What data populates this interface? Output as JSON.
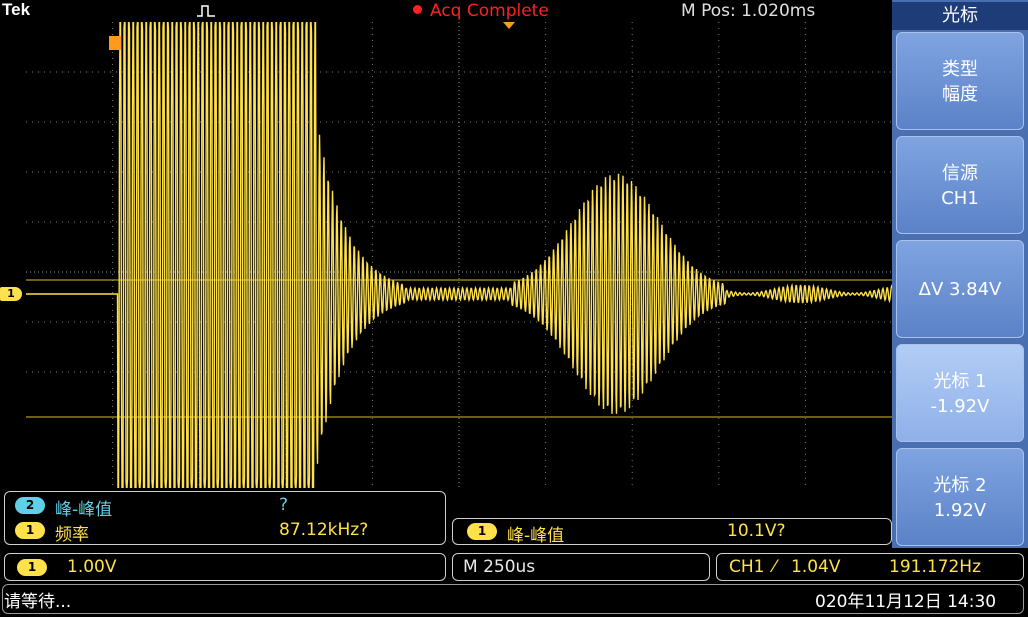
{
  "header": {
    "brand": "Tek",
    "acquisition_status": "Acq Complete",
    "position_readout": "M Pos: 1.020ms",
    "status_color": "#ff2020"
  },
  "channel_marker": "1",
  "side_menu": {
    "title": "光标",
    "buttons": [
      {
        "line1": "类型",
        "line2": "幅度"
      },
      {
        "line1": "信源",
        "line2": "CH1"
      },
      {
        "line1": "ΔV 3.84V",
        "line2": ""
      },
      {
        "line1": "光标 1",
        "line2": "-1.92V"
      },
      {
        "line1": "光标 2",
        "line2": "1.92V"
      }
    ]
  },
  "measurements": {
    "left": [
      {
        "channel": "2",
        "name": "峰-峰值",
        "value": "?"
      },
      {
        "channel": "1",
        "name": "频率",
        "value": "87.12kHz?"
      }
    ],
    "right": {
      "channel": "1",
      "name": "峰-峰值",
      "value": "10.1V?"
    }
  },
  "bottom_bar": {
    "ch1_badge": "1",
    "ch1_scale": "1.00V",
    "timebase": "M 250us",
    "trigger_source": "CH1",
    "trigger_slope": "⁄",
    "trigger_level": "1.04V",
    "trigger_frequency": "191.172Hz",
    "status_message": "请等待...",
    "datetime": "020年11月12日 14:30"
  },
  "colors": {
    "ch1": "#ffe14a",
    "ch2": "#5fd0e8",
    "menu": "#4a6fb0"
  },
  "icons": [
    "pulse-trigger-icon",
    "trigger-position-marker-icon",
    "acquisition-dot-icon"
  ]
}
